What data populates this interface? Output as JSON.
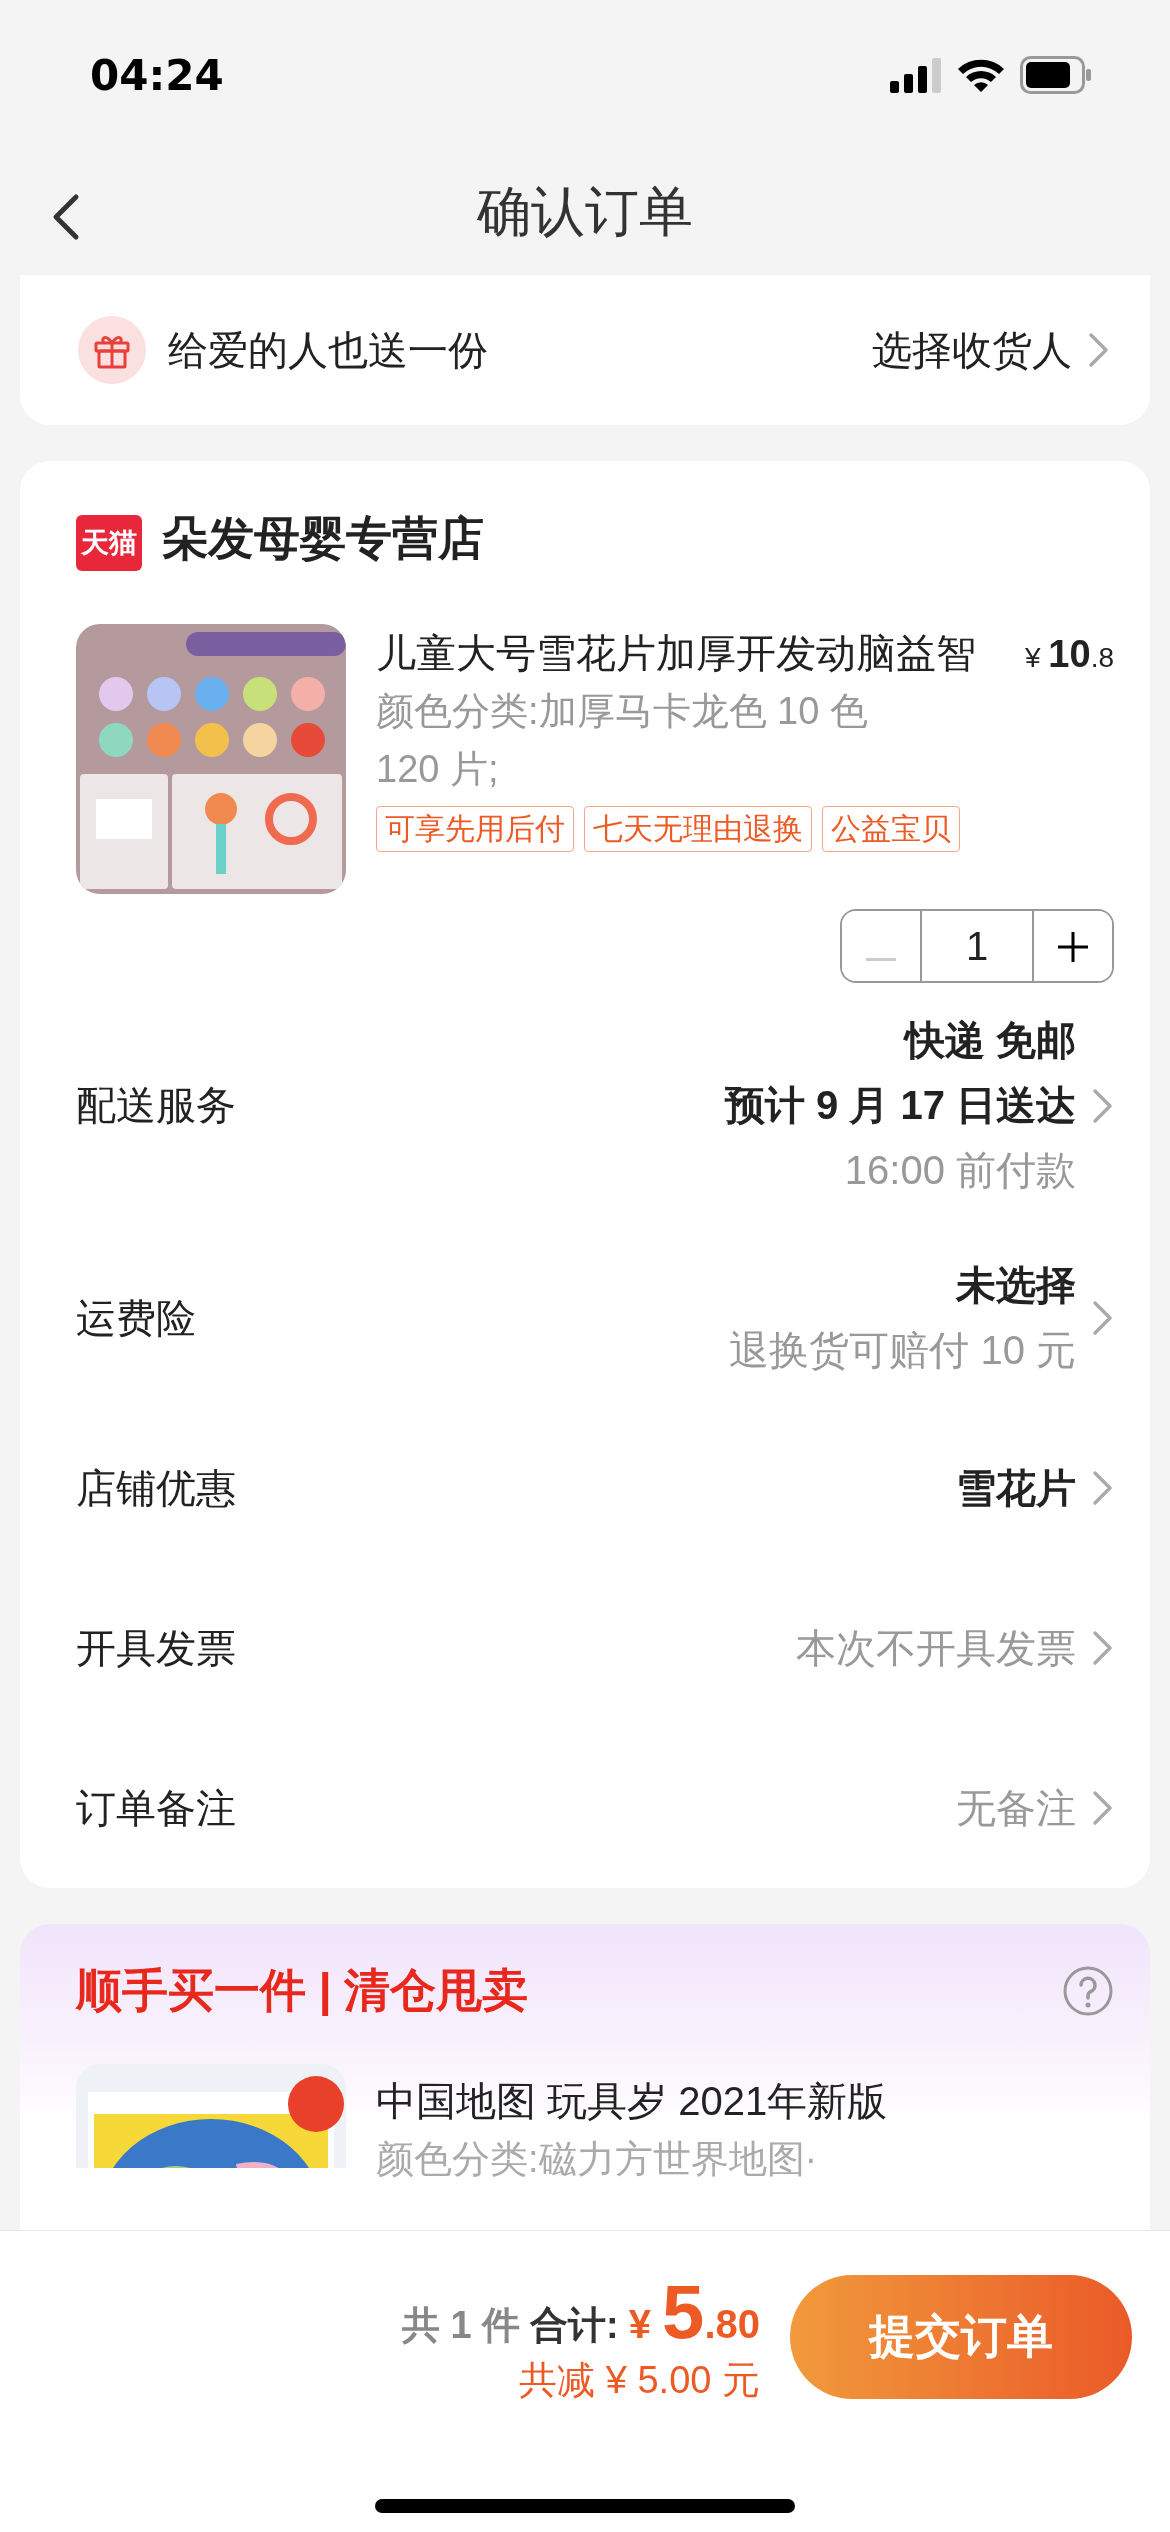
{
  "status_bar": {
    "time": "04:24"
  },
  "nav": {
    "title": "确认订单"
  },
  "gift": {
    "label": "给爱的人也送一份",
    "action": "选择收货人"
  },
  "store": {
    "badge": "天猫",
    "name": "朵发母婴专营店"
  },
  "product": {
    "kind": "picture",
    "title": "儿童大号雪花片加厚开发动脑益智",
    "currency": "¥",
    "price_int": "10",
    "price_dec": ".8",
    "spec_lines": [
      "颜色分类:加厚马卡龙色 10 色",
      "120 片;"
    ],
    "tags": [
      "可享先用后付",
      "七天无理由退换",
      "公益宝贝"
    ],
    "quantity": "1",
    "decrease_disabled": true
  },
  "rows": [
    {
      "label": "配送服务",
      "lines": [
        {
          "text": "快递 免邮",
          "kind": "strong"
        },
        {
          "text": "预计 9 月 17 日送达",
          "kind": "strong"
        },
        {
          "text": "16:00 前付款",
          "kind": "muted"
        }
      ]
    },
    {
      "label": "运费险",
      "lines": [
        {
          "text": "未选择",
          "kind": "strong"
        },
        {
          "text": "退换货可赔付 10 元",
          "kind": "muted"
        }
      ]
    },
    {
      "label": "店铺优惠",
      "lines": [
        {
          "text": "雪花片",
          "kind": "strong"
        }
      ]
    },
    {
      "label": "开具发票",
      "lines": [
        {
          "text": "本次不开具发票",
          "kind": "muted"
        }
      ]
    },
    {
      "label": "订单备注",
      "lines": [
        {
          "text": "无备注",
          "kind": "muted"
        }
      ]
    }
  ],
  "upsell": {
    "title": "顺手买一件 | 清仓甩卖",
    "product": {
      "kind": "picture",
      "title": "中国地图 玩具岁 2021年新版",
      "spec": "颜色分类:磁力方世界地图·"
    }
  },
  "footer": {
    "count": "共 1 件",
    "total_label": "合计:",
    "currency": "¥",
    "total_int": "5",
    "total_dec": ".80",
    "saving": "共减 ¥ 5.00 元",
    "submit": "提交订单"
  }
}
